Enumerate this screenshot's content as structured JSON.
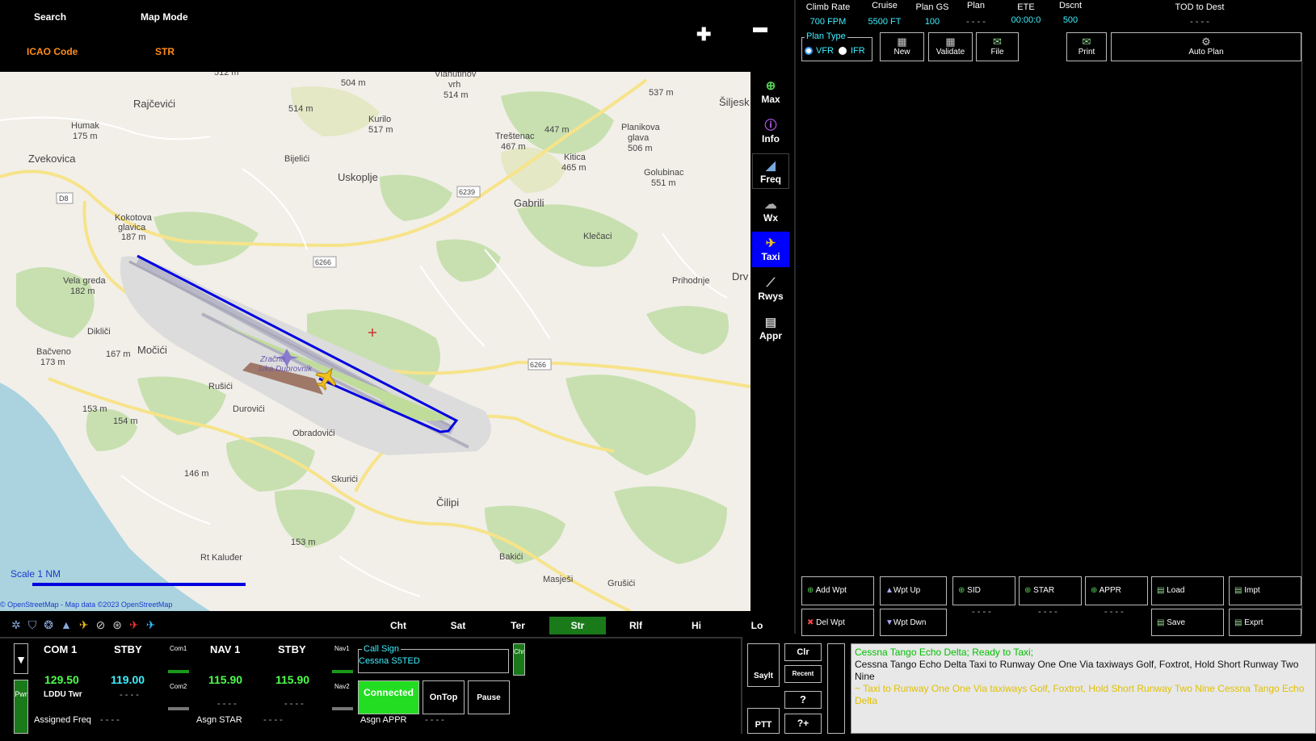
{
  "header": {
    "search_label": "Search",
    "map_mode_label": "Map Mode",
    "icao_label": "ICAO Code",
    "icao_value": "STR",
    "zoom_in": "✚",
    "zoom_out": "▬"
  },
  "map": {
    "places": [
      "Rajčevići",
      "Humak 175 m",
      "Zvekovica",
      "Bijelići",
      "Uskoplje",
      "Gabrili",
      "Kokotova glavica 187 m",
      "Vela greda 182 m",
      "Dikliči",
      "Močići",
      "Bačveno 173 m",
      "Rušići",
      "Durovići",
      "Obradovići",
      "Skurići",
      "Čilipi",
      "Bakići",
      "Masješi",
      "Grušići",
      "Klečaci",
      "Prihodnje",
      "Kurilo 517 m",
      "Vlahutinov vrh 514 m",
      "Treštenac 467 m",
      "Kitica 465 m",
      "Planikova glava 506 m",
      "Golubinac 551 m",
      "Šiljesk",
      "Drv",
      "Rt Kaluđer",
      "Zračna luka Dubrovnik"
    ],
    "elevations": [
      "512 m",
      "504 m",
      "514 m",
      "447 m",
      "537 m",
      "167 m",
      "153 m",
      "154 m",
      "146 m",
      "153 m"
    ],
    "road_labels": [
      "D8",
      "6239",
      "6266",
      "6266"
    ],
    "scale_label": "Scale 1 NM",
    "attribution": "© OpenStreetMap - Map data ©2023 OpenStreetMap"
  },
  "tools": [
    {
      "id": "max",
      "label": "Max",
      "icon": "plus-circle-icon"
    },
    {
      "id": "info",
      "label": "Info",
      "icon": "info-icon"
    },
    {
      "id": "freq",
      "label": "Freq",
      "icon": "radio-icon"
    },
    {
      "id": "wx",
      "label": "Wx",
      "icon": "weather-icon"
    },
    {
      "id": "taxi",
      "label": "Taxi",
      "icon": "taxi-plane-icon",
      "active": true
    },
    {
      "id": "rwys",
      "label": "Rwys",
      "icon": "runway-icon"
    },
    {
      "id": "appr",
      "label": "Appr",
      "icon": "approach-icon"
    }
  ],
  "flightplan": {
    "stats": [
      {
        "label": "Climb Rate",
        "value": "700 FPM"
      },
      {
        "label": "Cruise",
        "value": "5500 FT"
      },
      {
        "label": "Plan GS",
        "value": "100"
      },
      {
        "label": "Plan",
        "value": "- - - -"
      },
      {
        "label": "ETE",
        "value": "00:00:0"
      },
      {
        "label": "Dscnt",
        "value": "500"
      },
      {
        "label": "TOD to Dest",
        "value": "- - - -"
      }
    ],
    "plan_type_label": "Plan Type",
    "vfr_label": "VFR",
    "ifr_label": "IFR",
    "buttons": {
      "new": "New",
      "validate": "Validate",
      "file": "File",
      "print": "Print",
      "auto_plan": "Auto Plan"
    },
    "bottom": {
      "add_wpt": "Add Wpt",
      "wpt_up": "Wpt Up",
      "sid": "SID",
      "star": "STAR",
      "appr": "APPR",
      "load": "Load",
      "impt": "Impt",
      "del_wpt": "Del Wpt",
      "wpt_dwn": "Wpt Dwn",
      "save": "Save",
      "exprt": "Exprt",
      "sid_val": "- - - -",
      "star_val": "- - - -",
      "appr_val": "- - - -"
    }
  },
  "map_tabs": [
    {
      "label": "Cht"
    },
    {
      "label": "Sat"
    },
    {
      "label": "Ter"
    },
    {
      "label": "Str",
      "active": true
    },
    {
      "label": "Rlf"
    },
    {
      "label": "Hi"
    },
    {
      "label": "Lo"
    }
  ],
  "radio": {
    "com1_label": "COM 1",
    "com1_freq": "129.50",
    "com1_station": "LDDU Twr",
    "stby1_label": "STBY",
    "stby1_freq": "119.00",
    "stby1_station": "- - - -",
    "com1_small": "Com1",
    "com2_small": "Com2",
    "nav1_label": "NAV 1",
    "nav1_freq": "115.90",
    "nav1_station": "- - - -",
    "stby2_label": "STBY",
    "stby2_freq": "115.90",
    "stby2_station": "- - - -",
    "nav1_small": "Nav1",
    "nav2_small": "Nav2",
    "assigned_freq_label": "Assigned Freq",
    "assigned_freq_value": "- - - -",
    "asgn_star_label": "Asgn STAR",
    "asgn_star_value": "- - - -",
    "asgn_appr_label": "Asgn APPR",
    "asgn_appr_value": "- - - -",
    "pwr_label": "Pwr"
  },
  "callsign": {
    "label": "Call Sign",
    "value": "Cessna S5TED",
    "chr_label": "Chr",
    "connected_label": "Connected",
    "ontop_label": "OnTop",
    "pause_label": "Pause"
  },
  "comms": {
    "saylt": "Saylt",
    "ptt": "PTT",
    "clr": "Clr",
    "recent": "Recent",
    "help": "?",
    "help_plus": "?+",
    "messages": [
      {
        "type": "pilot",
        "text": "Cessna Tango Echo Delta;  Ready to Taxi;"
      },
      {
        "type": "atc",
        "text": "Cessna Tango Echo Delta  Taxi to Runway One One Via taxiways Golf, Foxtrot,  Hold Short Runway Two Nine"
      },
      {
        "type": "readback",
        "text": "~  Taxi to Runway One One Via taxiways Golf, Foxtrot,  Hold Short Runway Two Nine Cessna Tango Echo Delta"
      }
    ]
  },
  "colors": {
    "accent_orange": "#ff8c1a",
    "active_blue": "#0000ff",
    "freq_green": "#4dff4d",
    "freq_cyan": "#3df0ff",
    "connected_green": "#22dd22"
  }
}
